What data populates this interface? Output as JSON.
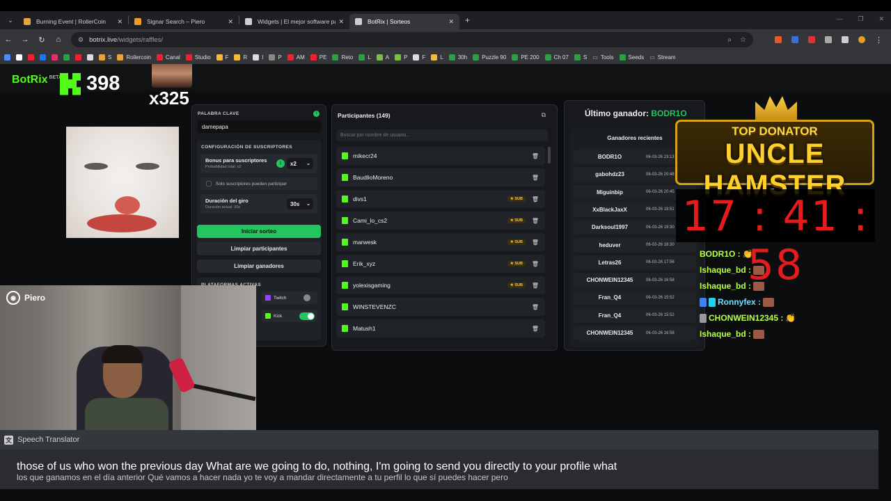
{
  "browser": {
    "tabs": [
      {
        "title": "Burning Event | RollerCoin",
        "fav": "#e8a33c"
      },
      {
        "title": "Signar Search – Piero",
        "fav": "#f59a23"
      },
      {
        "title": "Widgets | El mejor software para",
        "fav": "#cfcfcf"
      },
      {
        "title": "BotRix | Sorteos",
        "fav": "#cfcfcf"
      }
    ],
    "url_host": "botrix.live",
    "url_path": "/widgets/raffles/",
    "bookmarks": [
      "S",
      "Rollercoin",
      "Canal",
      "Studio",
      "F",
      "R",
      "I",
      "P",
      "AM",
      "PE",
      "Reto",
      "L",
      "A",
      "P",
      "F",
      "L",
      "30h",
      "Puzzle 90",
      "PE 200",
      "Ch 07",
      "S",
      "Tools",
      "Seeds",
      "Stream"
    ]
  },
  "overlay": {
    "brand": "BotRix",
    "brand_tag": "BETA",
    "follower_count": "398",
    "multiplier": "x325"
  },
  "config": {
    "keyword_label": "PALABRA CLAVE",
    "keyword_value": "damepapa",
    "subs_section": "CONFIGURACIÓN DE SUSCRIPTORES",
    "bonus_label": "Bonus para suscriptores",
    "bonus_sub": "Probabilidad total: x2",
    "bonus_value": "x2",
    "only_subs_label": "Solo suscriptores pueden participar",
    "duration_label": "Duración del giro",
    "duration_sub": "Duración actual: 30s",
    "duration_value": "30s",
    "start_button": "Iniciar sorteo",
    "clear_participants": "Limpiar participantes",
    "clear_winners": "Limpiar ganadores",
    "platforms_label": "PLATAFORMAS ACTIVAS",
    "platform_twitch": "Twitch",
    "platform_kick": "Kick"
  },
  "participants": {
    "title": "Participantes (149)",
    "search_placeholder": "Buscar por nombre de usuario...",
    "sub_badge": "★ SUB",
    "rows": [
      {
        "name": "mikecr24",
        "sub": false
      },
      {
        "name": "BaudlioMoreno",
        "sub": false
      },
      {
        "name": "divs1",
        "sub": true
      },
      {
        "name": "Cami_lo_cs2",
        "sub": true
      },
      {
        "name": "marwesk",
        "sub": true
      },
      {
        "name": "Erik_xyz",
        "sub": true
      },
      {
        "name": "yolexisgaming",
        "sub": true
      },
      {
        "name": "WINSTEVENZC",
        "sub": false
      },
      {
        "name": "Matush1",
        "sub": false
      }
    ]
  },
  "winner": {
    "label": "Último ganador:",
    "name": "BODR1O",
    "recent_title": "Ganadores recientes",
    "rows": [
      {
        "name": "BODR1O",
        "date": "06-03-26 23:13"
      },
      {
        "name": "gabohdz23",
        "date": "06-03-26 20:48"
      },
      {
        "name": "Miguinbip",
        "date": "06-03-26 20:45"
      },
      {
        "name": "XxBlackJaxX",
        "date": "06-03-26 19:51"
      },
      {
        "name": "Darksoul1997",
        "date": "06-03-26 19:30"
      },
      {
        "name": "heduver",
        "date": "06-03-26 18:30"
      },
      {
        "name": "Letras26",
        "date": "06-03-26 17:56"
      },
      {
        "name": "CHONWEIN12345",
        "date": "06-03-26 16:58"
      },
      {
        "name": "Fran_Q4",
        "date": "06-03-26 15:52"
      },
      {
        "name": "Fran_Q4",
        "date": "06-03-26 15:52"
      },
      {
        "name": "CHONWEIN12345",
        "date": "06-03-26 16:58"
      }
    ]
  },
  "donator": {
    "top": "TOP DONATOR",
    "name": "UNCLE HAMSTER"
  },
  "clock": "17 : 41 : 58",
  "chat": [
    {
      "user": "BODR1O :",
      "color": "#b8ff4a"
    },
    {
      "user": "Ishaque_bd :",
      "color": "#b8ff4a"
    },
    {
      "user": "Ishaque_bd :",
      "color": "#b8ff4a"
    },
    {
      "user": "Ronnyfex :",
      "color": "#6fe0ff"
    },
    {
      "user": "CHONWEIN12345 :",
      "color": "#b8ff4a"
    },
    {
      "user": "Ishaque_bd :",
      "color": "#b8ff4a"
    }
  ],
  "cam": {
    "name": "Piero"
  },
  "translator": {
    "title": "Speech Translator",
    "english": "those of us who won the previous day What are we going to do, nothing, I'm going to send you directly to your profile what",
    "spanish": "los que ganamos en el día anterior Qué vamos a hacer nada yo te voy a mandar directamente a tu perfil lo que sí puedes hacer pero"
  }
}
